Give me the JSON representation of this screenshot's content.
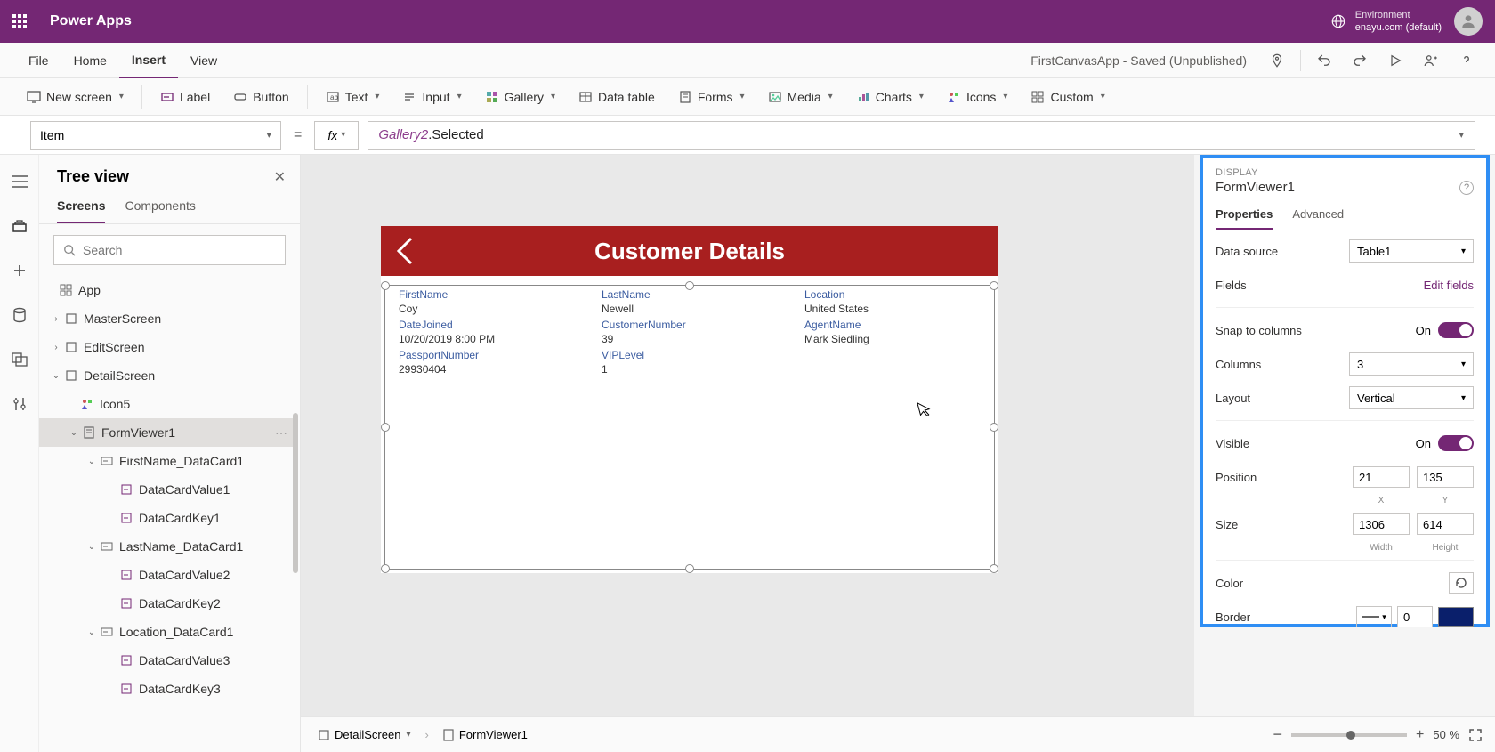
{
  "header": {
    "app_title": "Power Apps",
    "env_label": "Environment",
    "env_name": "enayu.com (default)"
  },
  "menubar": {
    "items": [
      "File",
      "Home",
      "Insert",
      "View"
    ],
    "active_index": 2,
    "app_status": "FirstCanvasApp - Saved (Unpublished)"
  },
  "ribbon": {
    "new_screen": "New screen",
    "label": "Label",
    "button": "Button",
    "text": "Text",
    "input": "Input",
    "gallery": "Gallery",
    "data_table": "Data table",
    "forms": "Forms",
    "media": "Media",
    "charts": "Charts",
    "icons": "Icons",
    "custom": "Custom"
  },
  "formula": {
    "property": "Item",
    "func_token": "Gallery2",
    "rest": ".Selected"
  },
  "tree": {
    "title": "Tree view",
    "tab_screens": "Screens",
    "tab_components": "Components",
    "search_placeholder": "Search",
    "nodes": {
      "app": "App",
      "master": "MasterScreen",
      "edit": "EditScreen",
      "detail": "DetailScreen",
      "icon5": "Icon5",
      "formviewer": "FormViewer1",
      "fn_dc": "FirstName_DataCard1",
      "dcv1": "DataCardValue1",
      "dck1": "DataCardKey1",
      "ln_dc": "LastName_DataCard1",
      "dcv2": "DataCardValue2",
      "dck2": "DataCardKey2",
      "loc_dc": "Location_DataCard1",
      "dcv3": "DataCardValue3",
      "dck3": "DataCardKey3"
    }
  },
  "canvas": {
    "screen_title": "Customer Details",
    "fields": [
      {
        "label": "FirstName",
        "value": "Coy"
      },
      {
        "label": "LastName",
        "value": "Newell"
      },
      {
        "label": "Location",
        "value": "United States"
      },
      {
        "label": "DateJoined",
        "value": "10/20/2019 8:00 PM"
      },
      {
        "label": "CustomerNumber",
        "value": "39"
      },
      {
        "label": "AgentName",
        "value": "Mark Siedling"
      },
      {
        "label": "PassportNumber",
        "value": "29930404"
      },
      {
        "label": "VIPLevel",
        "value": "1"
      }
    ]
  },
  "props": {
    "display_label": "DISPLAY",
    "control_name": "FormViewer1",
    "tab_props": "Properties",
    "tab_adv": "Advanced",
    "data_source_lbl": "Data source",
    "data_source_val": "Table1",
    "fields_lbl": "Fields",
    "edit_fields": "Edit fields",
    "snap_lbl": "Snap to columns",
    "on_text": "On",
    "columns_lbl": "Columns",
    "columns_val": "3",
    "layout_lbl": "Layout",
    "layout_val": "Vertical",
    "visible_lbl": "Visible",
    "position_lbl": "Position",
    "pos_x": "21",
    "pos_y": "135",
    "x_lbl": "X",
    "y_lbl": "Y",
    "size_lbl": "Size",
    "size_w": "1306",
    "size_h": "614",
    "w_lbl": "Width",
    "h_lbl": "Height",
    "color_lbl": "Color",
    "border_lbl": "Border",
    "border_val": "0"
  },
  "bottom": {
    "screen": "DetailScreen",
    "control": "FormViewer1",
    "zoom": "50",
    "pct": "%"
  }
}
